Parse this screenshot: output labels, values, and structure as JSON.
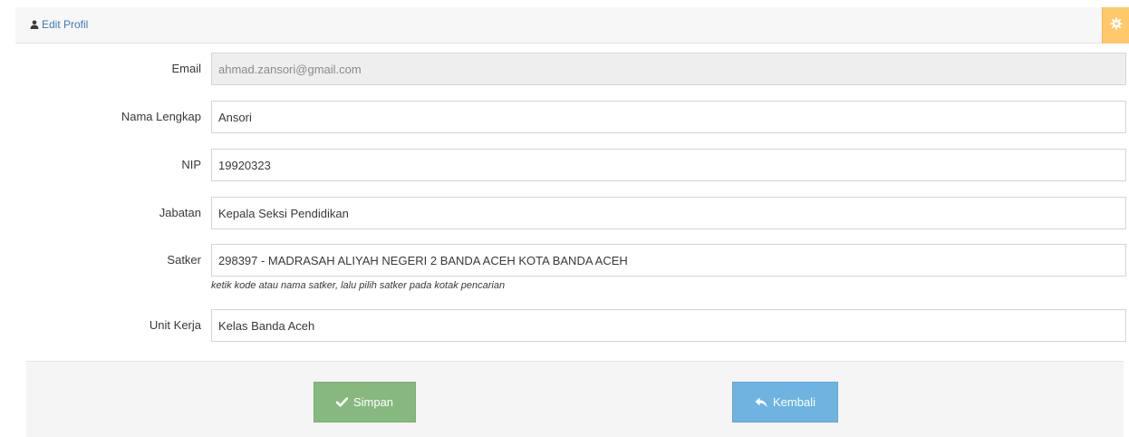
{
  "header": {
    "title": "Edit Profil",
    "icon": "user-icon",
    "settings_icon": "gear-icon",
    "settings_color": "#ffc86b"
  },
  "form": {
    "email": {
      "label": "Email",
      "value": "ahmad.zansori@gmail.com",
      "readonly": true
    },
    "nama_lengkap": {
      "label": "Nama Lengkap",
      "value": "Ansori"
    },
    "nip": {
      "label": "NIP",
      "value": "19920323"
    },
    "jabatan": {
      "label": "Jabatan",
      "value": "Kepala Seksi Pendidikan"
    },
    "satker": {
      "label": "Satker",
      "value": "298397 - MADRASAH ALIYAH NEGERI 2 BANDA ACEH KOTA BANDA ACEH",
      "help": "ketik kode atau nama satker, lalu pilih satker pada kotak pencarian"
    },
    "unit_kerja": {
      "label": "Unit Kerja",
      "value": "Kelas Banda Aceh"
    }
  },
  "actions": {
    "save_label": "Simpan",
    "save_icon": "check-icon",
    "save_color": "#87b87f",
    "back_label": "Kembali",
    "back_icon": "reply-icon",
    "back_color": "#6fb3e0"
  }
}
